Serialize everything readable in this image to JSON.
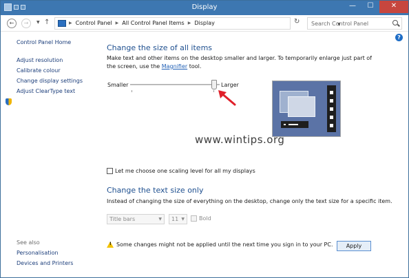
{
  "window": {
    "title": "Display"
  },
  "window_buttons": {
    "minimize": "—",
    "maximize": "☐",
    "close": "✕"
  },
  "nav": {
    "back_glyph": "←",
    "forward_glyph": "→",
    "up_glyph": "↑",
    "refresh_glyph": "↻"
  },
  "breadcrumb": [
    "Control Panel",
    "All Control Panel Items",
    "Display"
  ],
  "search": {
    "placeholder": "Search Control Panel"
  },
  "sidebar": {
    "home": "Control Panel Home",
    "items": [
      "Adjust resolution",
      "Calibrate colour",
      "Change display settings",
      "Adjust ClearType text"
    ],
    "see_also_label": "See also",
    "see_also": [
      "Personalisation",
      "Devices and Printers"
    ]
  },
  "main": {
    "help": "?",
    "section1_title": "Change the size of all items",
    "section1_desc_before": "Make text and other items on the desktop smaller and larger. To temporarily enlarge just part of the screen, use the ",
    "magnifier_link": "Magnifier",
    "section1_desc_after": " tool.",
    "slider": {
      "min_label": "Smaller",
      "max_label": "Larger",
      "level": 1.0
    },
    "watermark": "www.wintips.org",
    "scaling_checkbox": {
      "label": "Let me choose one scaling level for all my displays",
      "checked": false
    },
    "section2_title": "Change the text size only",
    "section2_desc": "Instead of changing the size of everything on the desktop, change only the text size for a specific item.",
    "item_select": "Title bars",
    "size_select": "11",
    "bold_label": "Bold",
    "warning": "Some changes might not be applied until the next time you sign in to your PC.",
    "apply_label": "Apply"
  },
  "colors": {
    "titlebar": "#3d77b1",
    "close": "#c7463e",
    "link": "#1b3d7a",
    "heading": "#1e4f8f",
    "arrow": "#e0202a"
  }
}
